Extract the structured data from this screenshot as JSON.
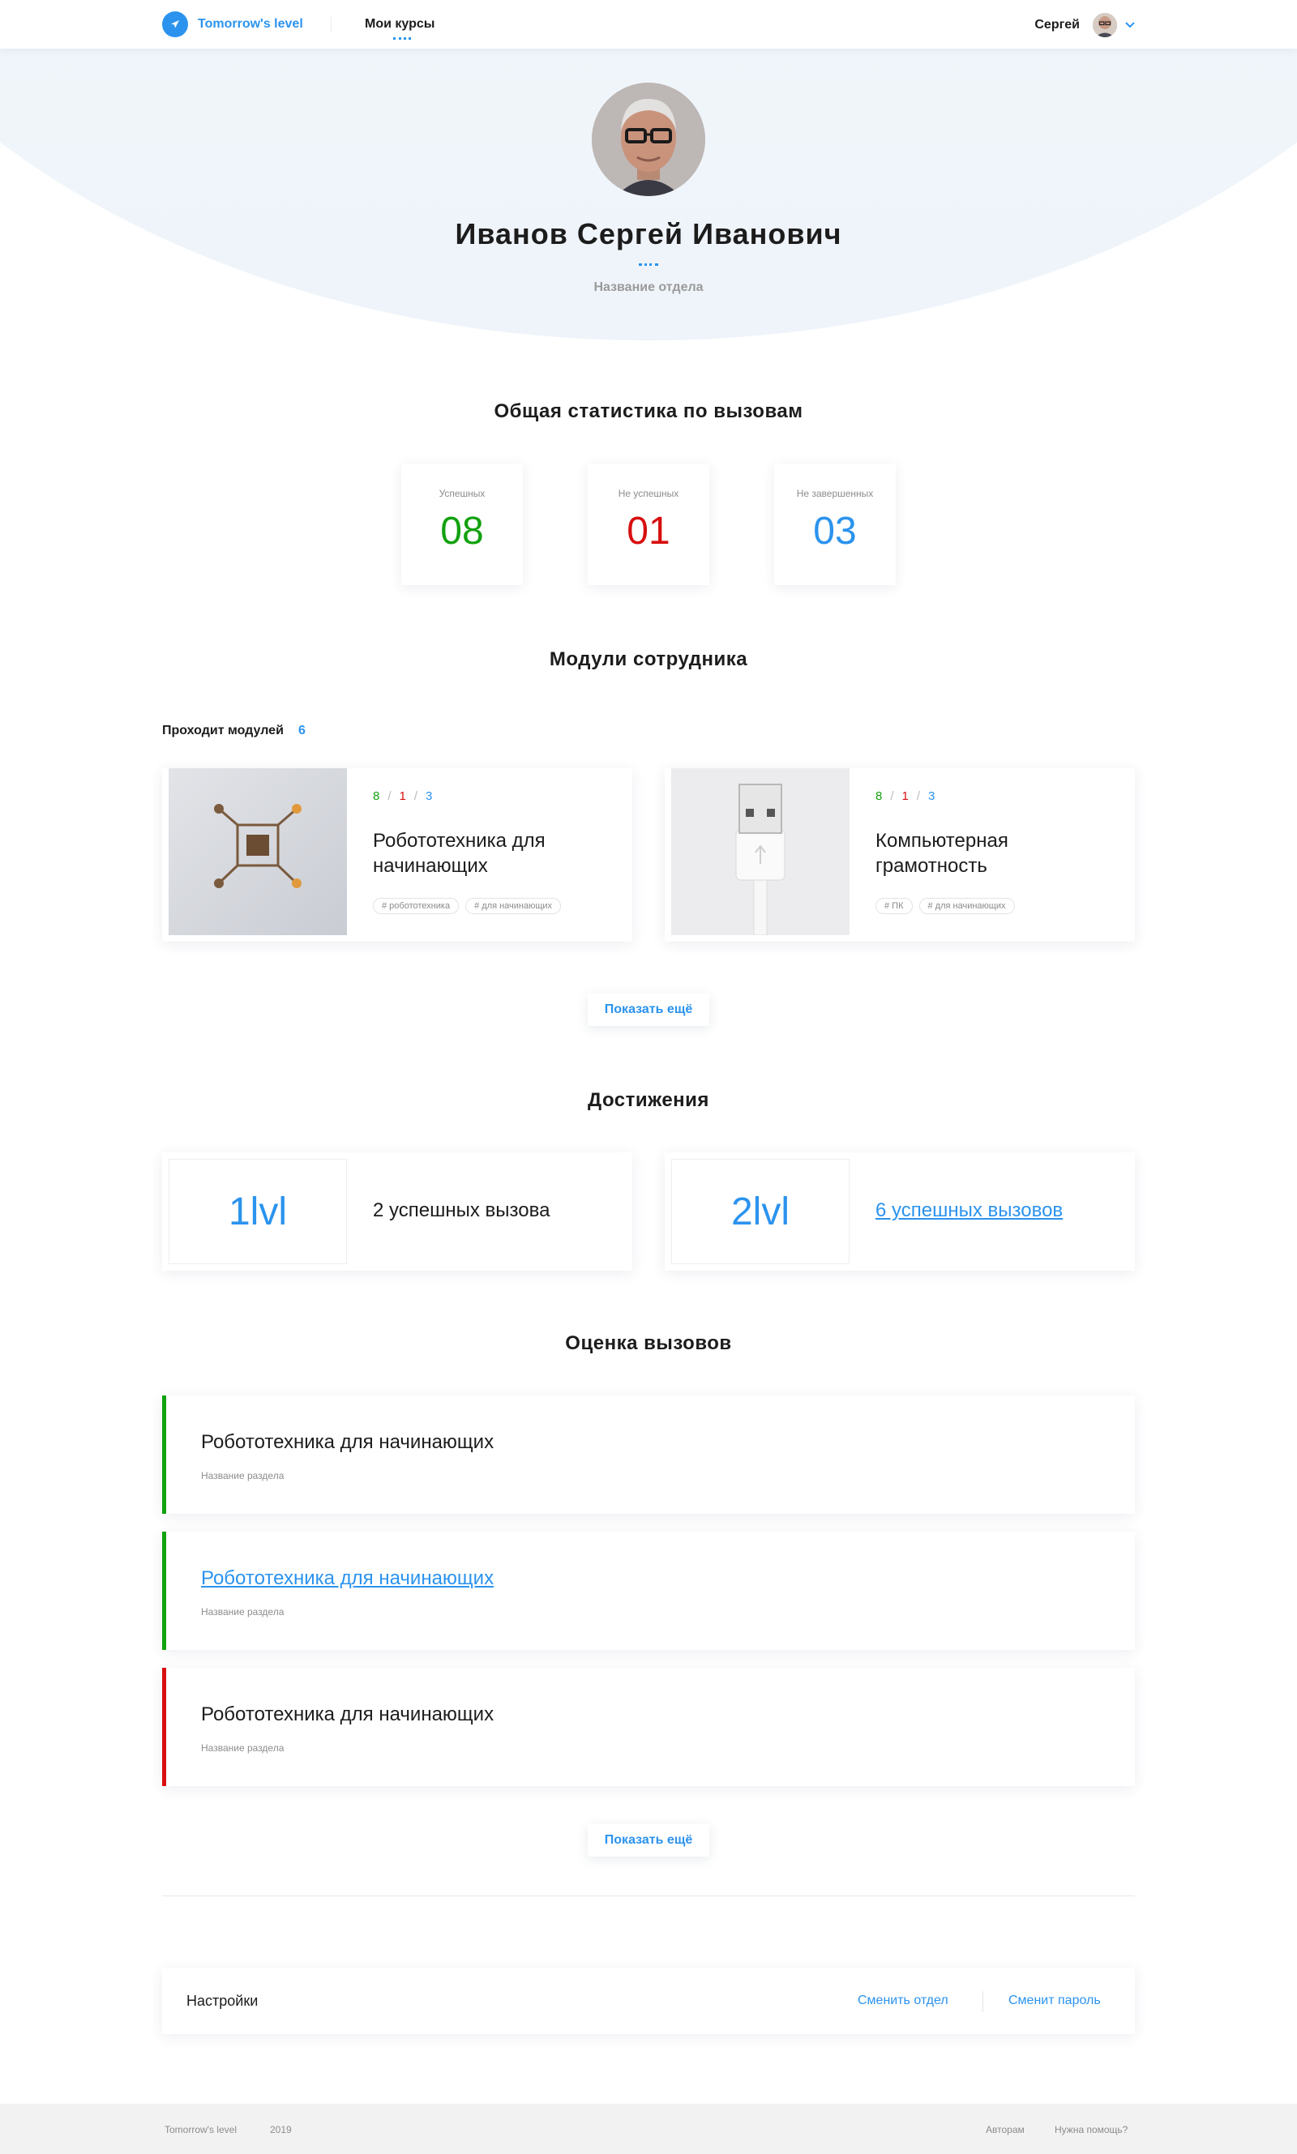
{
  "header": {
    "brand": "Tomorrow's level",
    "nav_label": "Мои курсы",
    "user_name": "Сергей"
  },
  "profile": {
    "name": "Иванов Сергей Иванович",
    "department": "Название отдела"
  },
  "stats": {
    "title": "Общая статистика по вызовам",
    "items": [
      {
        "label": "Успешных",
        "value": "08",
        "color": "#12a10f"
      },
      {
        "label": "Не успешных",
        "value": "01",
        "color": "#d70f0f"
      },
      {
        "label": "Не завершенных",
        "value": "03",
        "color": "#2b93ee"
      }
    ]
  },
  "modules": {
    "title": "Модули сотрудника",
    "in_progress_label": "Проходит модулей",
    "in_progress_count": "6",
    "cards": [
      {
        "success": "8",
        "fail": "1",
        "pending": "3",
        "sep": "/",
        "title": "Робототехника для начинающих",
        "tags": [
          "# робототехника",
          "# для начинающих"
        ]
      },
      {
        "success": "8",
        "fail": "1",
        "pending": "3",
        "sep": "/",
        "title": "Компьютерная грамотность",
        "tags": [
          "# ПК",
          "# для начинающих"
        ]
      }
    ],
    "more_label": "Показать ещё"
  },
  "achievements": {
    "title": "Достижения",
    "items": [
      {
        "level": "1lvl",
        "text": "2 успешных вызова"
      },
      {
        "level": "2lvl",
        "text": "6 успешных вызовов"
      }
    ]
  },
  "evaluation": {
    "title": "Оценка вызовов",
    "items": [
      {
        "title": "Робототехника для начинающих",
        "section": "Название раздела",
        "status_color": "#12a10f"
      },
      {
        "title": "Робототехника для начинающих",
        "section": "Название раздела",
        "status_color": "#12a10f"
      },
      {
        "title": "Робототехника для начинающих",
        "section": "Название раздела",
        "status_color": "#d70f0f"
      }
    ],
    "more_label": "Показать ещё"
  },
  "settings": {
    "title": "Настройки",
    "change_department": "Сменить отдел",
    "change_password": "Сменит пароль"
  },
  "footer": {
    "brand": "Tomorrow's level",
    "year": "2019",
    "authors": "Авторам",
    "help": "Нужна помощь?"
  },
  "colors": {
    "accent": "#2b93ee",
    "success": "#12a10f",
    "fail": "#d70f0f"
  }
}
